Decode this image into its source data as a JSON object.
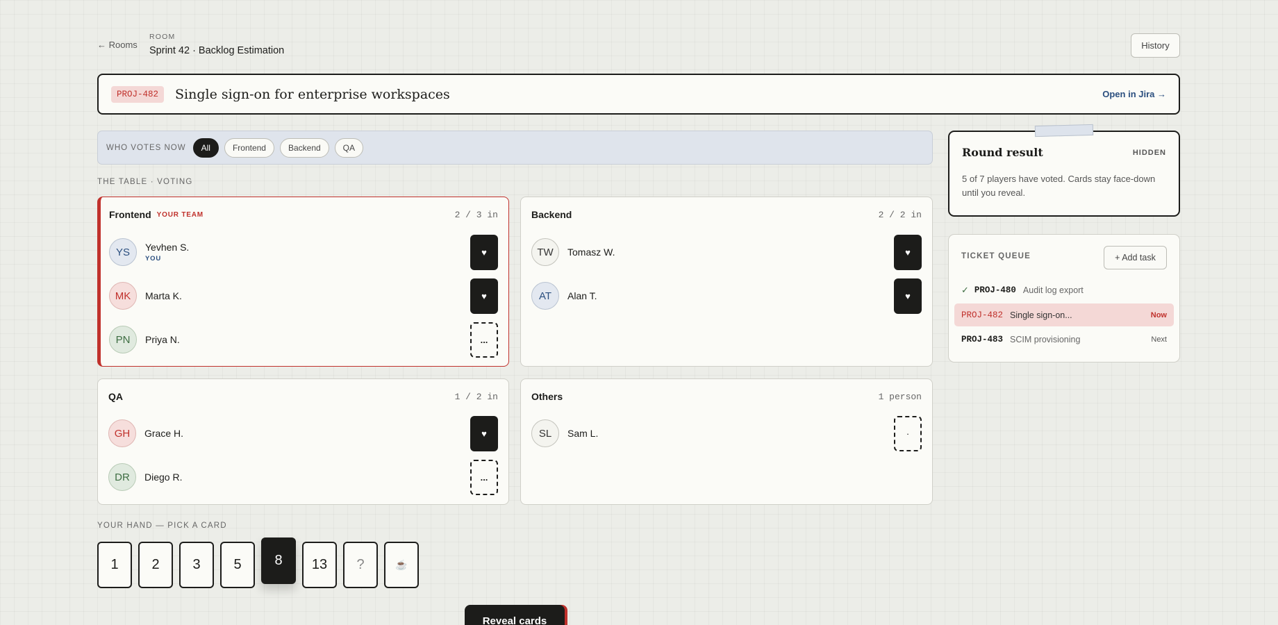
{
  "header": {
    "back_label": "← Rooms",
    "room_label": "ROOM",
    "room_title": "Sprint 42 · Backlog Estimation",
    "history_label": "History"
  },
  "ticket": {
    "key": "PROJ-482",
    "title": "Single sign-on for enterprise workspaces",
    "open_link": "Open in Jira →"
  },
  "filters": {
    "label": "WHO VOTES NOW",
    "options": [
      "All",
      "Frontend",
      "Backend",
      "QA"
    ],
    "selected": "All"
  },
  "table_label": "THE TABLE · VOTING",
  "teams": [
    {
      "name": "Frontend",
      "tag": "YOUR TEAM",
      "count": "2 / 3 in",
      "players": [
        {
          "initials": "YS",
          "name": "Yevhen S.",
          "sub": "YOU",
          "state": "voted",
          "card": "♥",
          "avatar_color": "blue"
        },
        {
          "initials": "MK",
          "name": "Marta K.",
          "state": "voted",
          "card": "♥",
          "avatar_color": "red"
        },
        {
          "initials": "PN",
          "name": "Priya N.",
          "state": "thinking",
          "card": "...",
          "avatar_color": "green"
        }
      ]
    },
    {
      "name": "Backend",
      "count": "2 / 2 in",
      "players": [
        {
          "initials": "TW",
          "name": "Tomasz W.",
          "state": "voted",
          "card": "♥",
          "avatar_color": "grey"
        },
        {
          "initials": "AT",
          "name": "Alan T.",
          "state": "voted",
          "card": "♥",
          "avatar_color": "blue"
        }
      ]
    },
    {
      "name": "QA",
      "count": "1 / 2 in",
      "players": [
        {
          "initials": "GH",
          "name": "Grace H.",
          "state": "voted",
          "card": "♥",
          "avatar_color": "red"
        },
        {
          "initials": "DR",
          "name": "Diego R.",
          "state": "thinking",
          "card": "...",
          "avatar_color": "green"
        }
      ]
    },
    {
      "name": "Others",
      "count": "1 person",
      "players": [
        {
          "initials": "SL",
          "name": "Sam L.",
          "state": "waiting",
          "card": "·",
          "avatar_color": "grey"
        }
      ]
    }
  ],
  "result": {
    "title": "Round result",
    "status": "HIDDEN",
    "text": "5 of 7 players have voted. Cards stay face-down until you reveal."
  },
  "queue": {
    "label": "TICKET QUEUE",
    "add_label": "+ Add task",
    "items": [
      {
        "check": "✓",
        "key": "PROJ-480",
        "name": "Audit log export",
        "status": ""
      },
      {
        "key": "PROJ-482",
        "name": "Single sign-on...",
        "status": "Now"
      },
      {
        "key": "PROJ-483",
        "name": "SCIM provisioning",
        "status": "Next"
      }
    ]
  },
  "hand": {
    "label": "YOUR HAND — PICK A CARD",
    "cards": [
      "1",
      "2",
      "3",
      "5",
      "8",
      "13",
      "?",
      "☕"
    ],
    "selected": "8"
  },
  "reveal_label": "Reveal cards",
  "colors": {
    "accent_red": "#c0312c",
    "ink": "#1c1c1a",
    "link_blue": "#2b4f7f",
    "filter_bg": "#dfe4ec"
  }
}
